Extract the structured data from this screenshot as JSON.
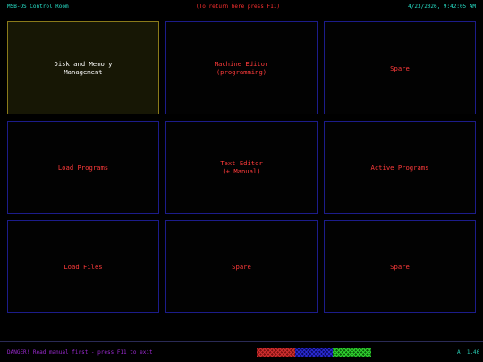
{
  "header": {
    "title": "MSB-OS Control Room",
    "hint": "(To return here press F11)",
    "datetime": "4/23/2026, 9:42:05 AM"
  },
  "tiles": [
    {
      "label": "Disk and Memory\nManagement",
      "selected": true
    },
    {
      "label": "Machine Editor\n(programming)",
      "selected": false
    },
    {
      "label": "Spare",
      "selected": false
    },
    {
      "label": "Load Programs",
      "selected": false
    },
    {
      "label": "Text Editor\n(+ Manual)",
      "selected": false
    },
    {
      "label": "Active Programs",
      "selected": false
    },
    {
      "label": "Load Files",
      "selected": false
    },
    {
      "label": "Spare",
      "selected": false
    },
    {
      "label": "Spare",
      "selected": false
    }
  ],
  "footer": {
    "warning": "DANGER! Read manual first - press F11 to exit",
    "status_segments": [
      {
        "color": "#d03030"
      },
      {
        "color": "#2a2ad0"
      },
      {
        "color": "#30d030"
      }
    ],
    "right_text": "A: 1.46"
  },
  "colors": {
    "background": "#000000",
    "header_text": "#27e0c8",
    "hint_text": "#ff3030",
    "tile_text": "#ff3b3b",
    "tile_border": "#1c1c8a",
    "selected_border": "#8a7a1a",
    "selected_fill": "#171705",
    "selected_text": "#ffffff",
    "warning_text": "#9a2ad0"
  }
}
